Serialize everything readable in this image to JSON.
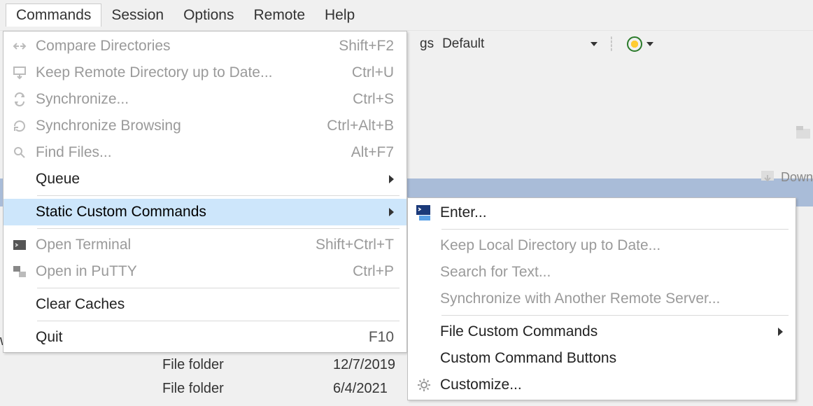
{
  "menubar": {
    "items": [
      "Commands",
      "Session",
      "Options",
      "Remote",
      "Help"
    ],
    "active_index": 0
  },
  "toolbar": {
    "settings_label_suffix": "gs",
    "dropdown_value": "Default",
    "download_label": "Down"
  },
  "commands_menu": [
    {
      "label": "Compare Directories",
      "shortcut": "Shift+F2",
      "enabled": false,
      "icon": "compare-icon"
    },
    {
      "label": "Keep Remote Directory up to Date...",
      "shortcut": "Ctrl+U",
      "enabled": false,
      "icon": "keep-remote-icon"
    },
    {
      "label": "Synchronize...",
      "shortcut": "Ctrl+S",
      "enabled": false,
      "icon": "sync-icon"
    },
    {
      "label": "Synchronize Browsing",
      "shortcut": "Ctrl+Alt+B",
      "enabled": false,
      "icon": "sync-browse-icon"
    },
    {
      "label": "Find Files...",
      "shortcut": "Alt+F7",
      "enabled": false,
      "icon": "find-icon"
    },
    {
      "label": "Queue",
      "shortcut": "",
      "enabled": true,
      "submenu": true,
      "icon": ""
    },
    {
      "sep": true
    },
    {
      "label": "Static Custom Commands",
      "shortcut": "",
      "enabled": true,
      "submenu": true,
      "highlight": true,
      "icon": ""
    },
    {
      "sep": true
    },
    {
      "label": "Open Terminal",
      "shortcut": "Shift+Ctrl+T",
      "enabled": false,
      "icon": "terminal-icon"
    },
    {
      "label": "Open in PuTTY",
      "shortcut": "Ctrl+P",
      "enabled": false,
      "icon": "putty-icon"
    },
    {
      "sep": true
    },
    {
      "label": "Clear Caches",
      "shortcut": "",
      "enabled": true,
      "icon": ""
    },
    {
      "sep": true
    },
    {
      "label": "Quit",
      "shortcut": "F10",
      "enabled": true,
      "icon": ""
    }
  ],
  "static_submenu": [
    {
      "label": "Enter...",
      "enabled": true,
      "icon": "console-icon"
    },
    {
      "sep": true
    },
    {
      "label": "Keep Local Directory up to Date...",
      "enabled": false
    },
    {
      "label": "Search for Text...",
      "enabled": false
    },
    {
      "label": "Synchronize with Another Remote Server...",
      "enabled": false
    },
    {
      "sep": true
    },
    {
      "label": "File Custom Commands",
      "enabled": true,
      "submenu": true
    },
    {
      "label": "Custom Command Buttons",
      "enabled": true
    },
    {
      "label": "Customize...",
      "enabled": true,
      "icon": "gear-icon"
    }
  ],
  "file_rows": [
    {
      "name": "wnloa...",
      "type": "",
      "date": ""
    },
    {
      "name": "",
      "type": "File folder",
      "date": "12/7/2019"
    },
    {
      "name": "",
      "type": "File folder",
      "date": "6/4/2021"
    }
  ]
}
